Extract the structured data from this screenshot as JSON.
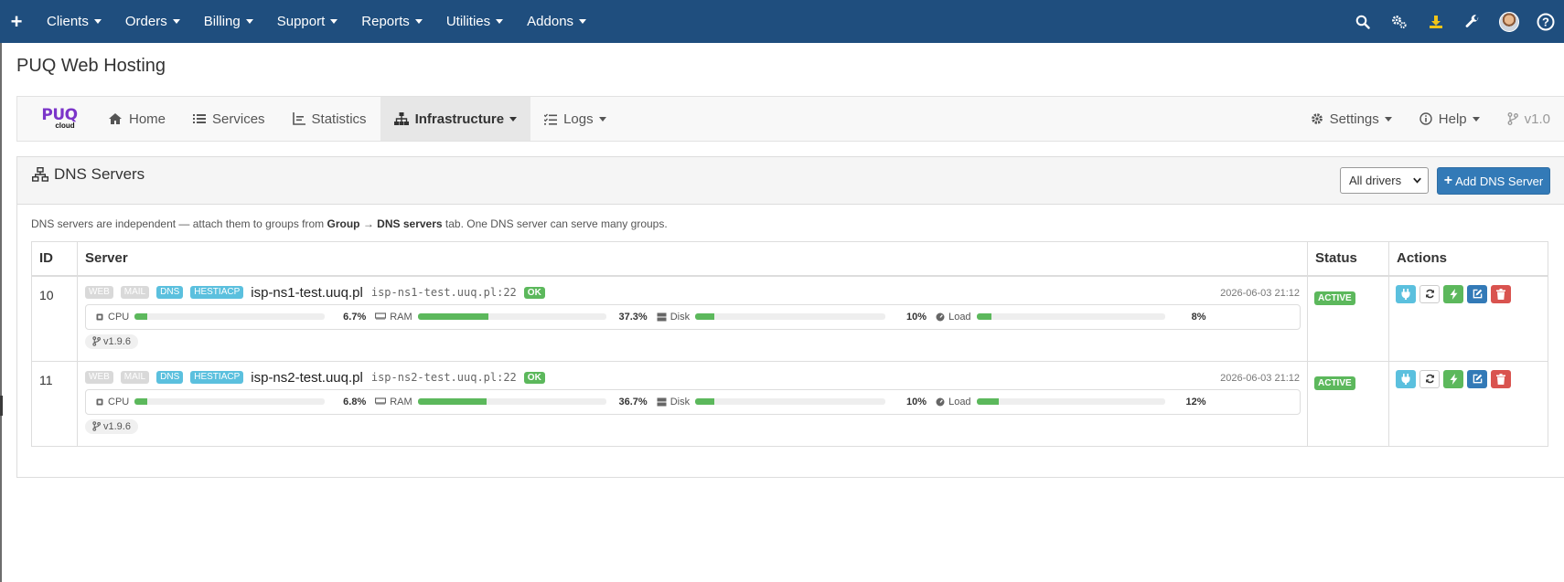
{
  "topbar": {
    "menu": [
      "Clients",
      "Orders",
      "Billing",
      "Support",
      "Reports",
      "Utilities",
      "Addons"
    ],
    "icons": [
      "search-icon",
      "cogs-icon",
      "download-icon",
      "wrench-icon",
      "avatar",
      "help-icon"
    ]
  },
  "page_title": "PUQ Web Hosting",
  "module_nav": {
    "logo_text": "PUQ",
    "logo_subtext": "cloud",
    "items": [
      {
        "label": "Home",
        "icon": "home-icon"
      },
      {
        "label": "Services",
        "icon": "list-icon"
      },
      {
        "label": "Statistics",
        "icon": "chart-icon"
      },
      {
        "label": "Infrastructure",
        "icon": "sitemap-icon",
        "active": true
      },
      {
        "label": "Logs",
        "icon": "tasks-icon"
      }
    ],
    "right": {
      "settings": "Settings",
      "help": "Help",
      "version": "v1.0"
    }
  },
  "panel": {
    "title": "DNS Servers",
    "driver_select": "All drivers",
    "add_button": "Add DNS Server",
    "hint": {
      "prefix": "DNS servers are independent — attach them to groups from ",
      "group": "Group",
      "arrow": " → ",
      "tab": "DNS servers",
      "suffix": " tab. One DNS server can serve many groups."
    }
  },
  "table": {
    "headers": {
      "id": "ID",
      "server": "Server",
      "status": "Status",
      "actions": "Actions"
    },
    "rows": [
      {
        "id": "10",
        "tags": [
          "WEB",
          "MAIL",
          "DNS",
          "HESTIACP"
        ],
        "hostname": "isp-ns1-test.uuq.pl",
        "hostport": "isp-ns1-test.uuq.pl:22",
        "conn": "OK",
        "date": "2026-06-03 21:12",
        "cpu_label": "CPU",
        "cpu": "6.7%",
        "cpu_pct": 6.7,
        "ram_label": "RAM",
        "ram": "37.3%",
        "ram_pct": 37.3,
        "disk_label": "Disk",
        "disk": "10%",
        "disk_pct": 10,
        "load_label": "Load",
        "load": "8%",
        "load_pct": 8,
        "version": "v1.9.6",
        "status": "ACTIVE"
      },
      {
        "id": "11",
        "tags": [
          "WEB",
          "MAIL",
          "DNS",
          "HESTIACP"
        ],
        "hostname": "isp-ns2-test.uuq.pl",
        "hostport": "isp-ns2-test.uuq.pl:22",
        "conn": "OK",
        "date": "2026-06-03 21:12",
        "cpu_label": "CPU",
        "cpu": "6.8%",
        "cpu_pct": 6.8,
        "ram_label": "RAM",
        "ram": "36.7%",
        "ram_pct": 36.7,
        "disk_label": "Disk",
        "disk": "10%",
        "disk_pct": 10,
        "load_label": "Load",
        "load": "12%",
        "load_pct": 12,
        "version": "v1.9.6",
        "status": "ACTIVE"
      }
    ]
  },
  "colors": {
    "topbar": "#1f4e7e",
    "primary": "#337ab7",
    "success": "#5cb85c",
    "info": "#5bc0de",
    "danger": "#d9534f",
    "logo": "#7b35c9"
  }
}
